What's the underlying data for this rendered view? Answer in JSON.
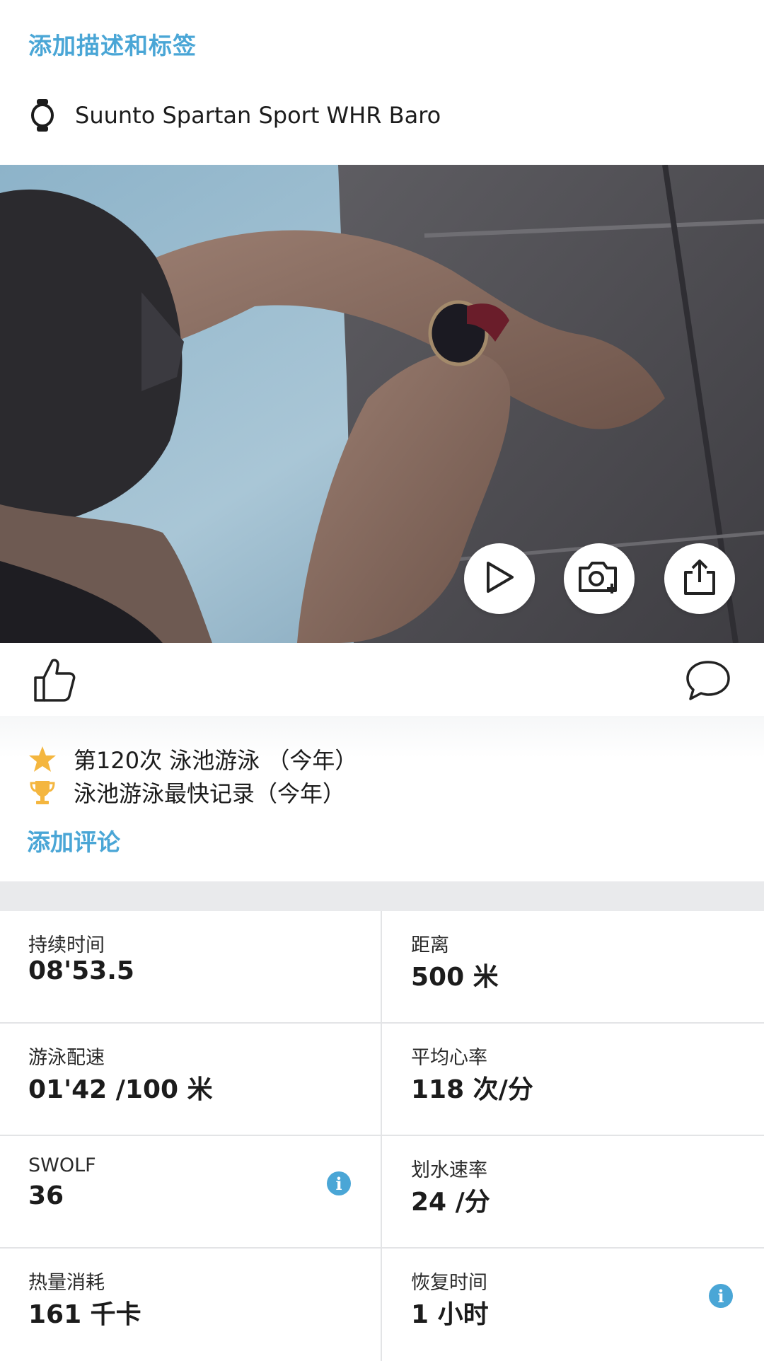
{
  "header": {
    "add_description_label": "添加描述和标签",
    "device_icon": "watch-icon",
    "device_name": "Suunto Spartan Sport WHR Baro"
  },
  "media": {
    "photo_description_icon": "photo",
    "buttons": [
      {
        "icon": "play-icon"
      },
      {
        "icon": "add-photo-icon"
      },
      {
        "icon": "share-icon"
      }
    ]
  },
  "social": {
    "like_icon": "thumbs-up-icon",
    "comment_icon": "comment-bubble-icon"
  },
  "achievements": [
    {
      "icon": "star-icon",
      "color": "#f4b63f",
      "text": "第120次 泳池游泳 （今年）"
    },
    {
      "icon": "trophy-icon",
      "color": "#f4b63f",
      "text": "泳池游泳最快记录（今年）"
    }
  ],
  "add_comment_label": "添加评论",
  "accent_color": "#4aa6d6",
  "stats": [
    {
      "label": "持续时间",
      "value": "08'53.5",
      "info": false
    },
    {
      "label": "距离",
      "value": "500 米",
      "info": false
    },
    {
      "label": "游泳配速",
      "value": "01'42 /100 米",
      "info": false
    },
    {
      "label": "平均心率",
      "value": "118 次/分",
      "info": false
    },
    {
      "label": "SWOLF",
      "value": "36",
      "info": true
    },
    {
      "label": "划水速率",
      "value": "24 /分",
      "info": false
    },
    {
      "label": "热量消耗",
      "value": "161 千卡",
      "info": false
    },
    {
      "label": "恢复时间",
      "value": "1 小时",
      "info": true
    }
  ],
  "info_glyph": "i"
}
